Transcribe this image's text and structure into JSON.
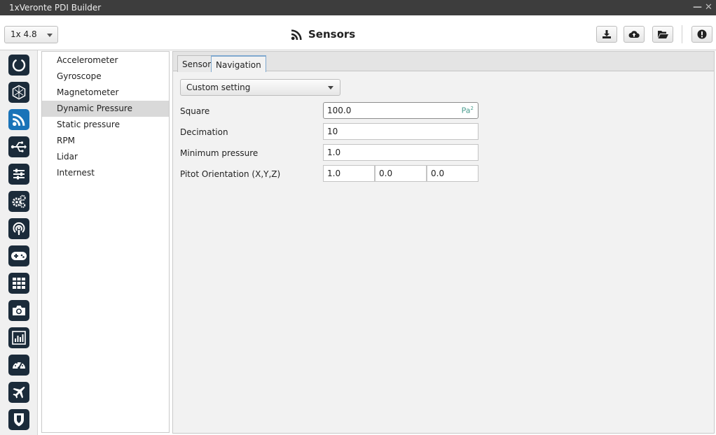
{
  "window": {
    "title": "1xVeronte PDI Builder",
    "minimize_glyph": "—",
    "close_glyph": "✕"
  },
  "toolbar": {
    "version": "1x 4.8",
    "title": "Sensors",
    "title_icon": "rss-icon",
    "buttons": [
      "download-icon",
      "cloud-upload-icon",
      "folder-open-icon",
      "alert-icon"
    ]
  },
  "nav_icons": [
    "power-icon",
    "hexagon-icon",
    "rss-icon",
    "usb-icon",
    "sliders-icon",
    "gears-icon",
    "podcast-icon",
    "gamepad-icon",
    "grid-icon",
    "camera-icon",
    "bar-chart-icon",
    "dashboard-icon",
    "plane-icon",
    "shield-icon"
  ],
  "active_nav": "rss-icon",
  "sensor_list": {
    "items": [
      "Accelerometer",
      "Gyroscope",
      "Magnetometer",
      "Dynamic Pressure",
      "Static pressure",
      "RPM",
      "Lidar",
      "Internest"
    ],
    "selected": "Dynamic Pressure"
  },
  "tabs": [
    {
      "label": "Sensor"
    },
    {
      "label": "Navigation"
    }
  ],
  "active_tab": "Navigation",
  "form": {
    "mode": "Custom setting",
    "square": {
      "label": "Square",
      "value": "100.0",
      "unit": "Pa",
      "unit_exp": "2"
    },
    "decimation": {
      "label": "Decimation",
      "value": "10"
    },
    "min_pressure": {
      "label": "Minimum pressure",
      "value": "1.0"
    },
    "pitot": {
      "label": "Pitot Orientation (X,Y,Z)",
      "x": "1.0",
      "y": "0.0",
      "z": "0.0"
    }
  },
  "colors": {
    "titlebar": "#3d3d3d",
    "nav_icon": "#1b2b3a",
    "nav_active": "#1a73b8",
    "selected_row": "#d9d9d9",
    "unit": "#4a9d8f"
  }
}
